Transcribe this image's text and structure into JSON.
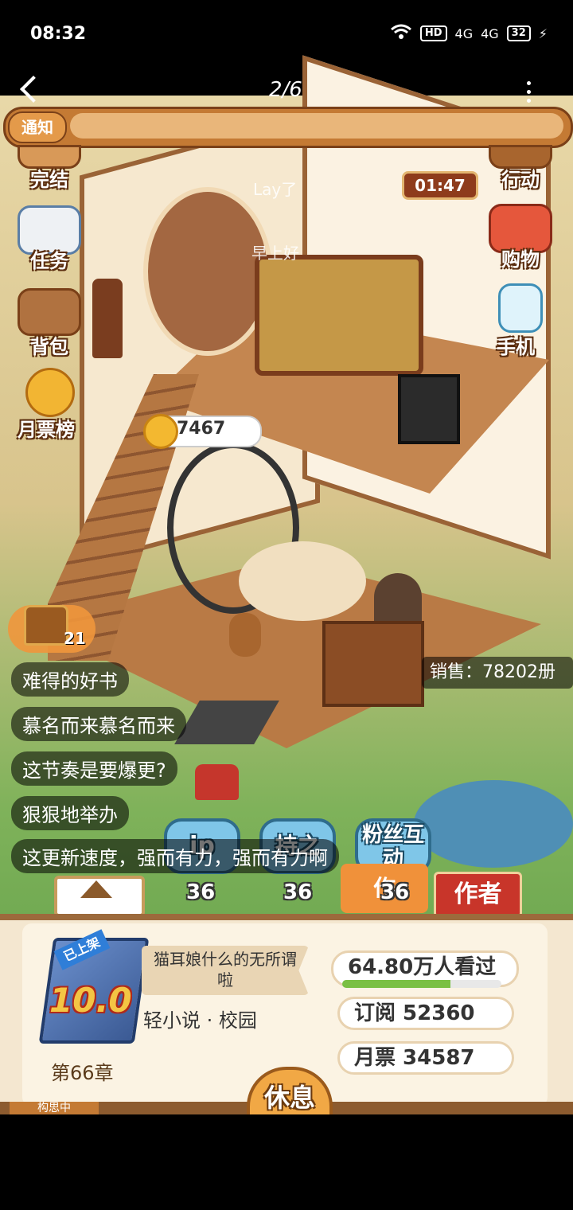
{
  "status_bar": {
    "time": "08:32",
    "hd": "HD",
    "net1": "4G",
    "net2": "4G",
    "battery": "32"
  },
  "top_nav": {
    "page_indicator": "2/6"
  },
  "notice": {
    "tag": "通知"
  },
  "side_left": [
    {
      "label": "完结",
      "icon": "book-icon"
    },
    {
      "label": "任务",
      "icon": "checklist-icon"
    },
    {
      "label": "背包",
      "icon": "bag-icon"
    },
    {
      "label": "月票榜",
      "icon": "coin-icon"
    }
  ],
  "side_right": [
    {
      "label": "行动",
      "icon": "door-icon"
    },
    {
      "label": "购物",
      "icon": "shop-icon"
    },
    {
      "label": "手机",
      "icon": "phone-icon"
    }
  ],
  "timer": "01:47",
  "float_texts": [
    "Lay了",
    "早上好"
  ],
  "coin_bubble": {
    "value": "7467"
  },
  "chest": {
    "count": "21"
  },
  "chat": [
    "难得的好书",
    "慕名而来慕名而来",
    "这节奏是要爆更?",
    "狠狠地举办",
    "这更新速度，强而有力，强而有力啊"
  ],
  "sales": "销售：78202册",
  "actions": [
    {
      "label": "ip",
      "count": "36"
    },
    {
      "label": "持之",
      "count": "36"
    },
    {
      "label": "粉丝互动",
      "count": "36"
    }
  ],
  "author_side": "作",
  "author_button": "作者",
  "book": {
    "badge": "已上架",
    "score": "10.0",
    "title": "猫耳娘什么的无所谓啦",
    "genre": "轻小说 · 校园",
    "chapter": "第66章"
  },
  "stats": {
    "views": "64.80万人看过",
    "views_progress": 0.68,
    "subscriptions": "订阅 52360",
    "monthly_votes": "月票 34587"
  },
  "rest_button": "休息",
  "bottom_tab": "构思中"
}
